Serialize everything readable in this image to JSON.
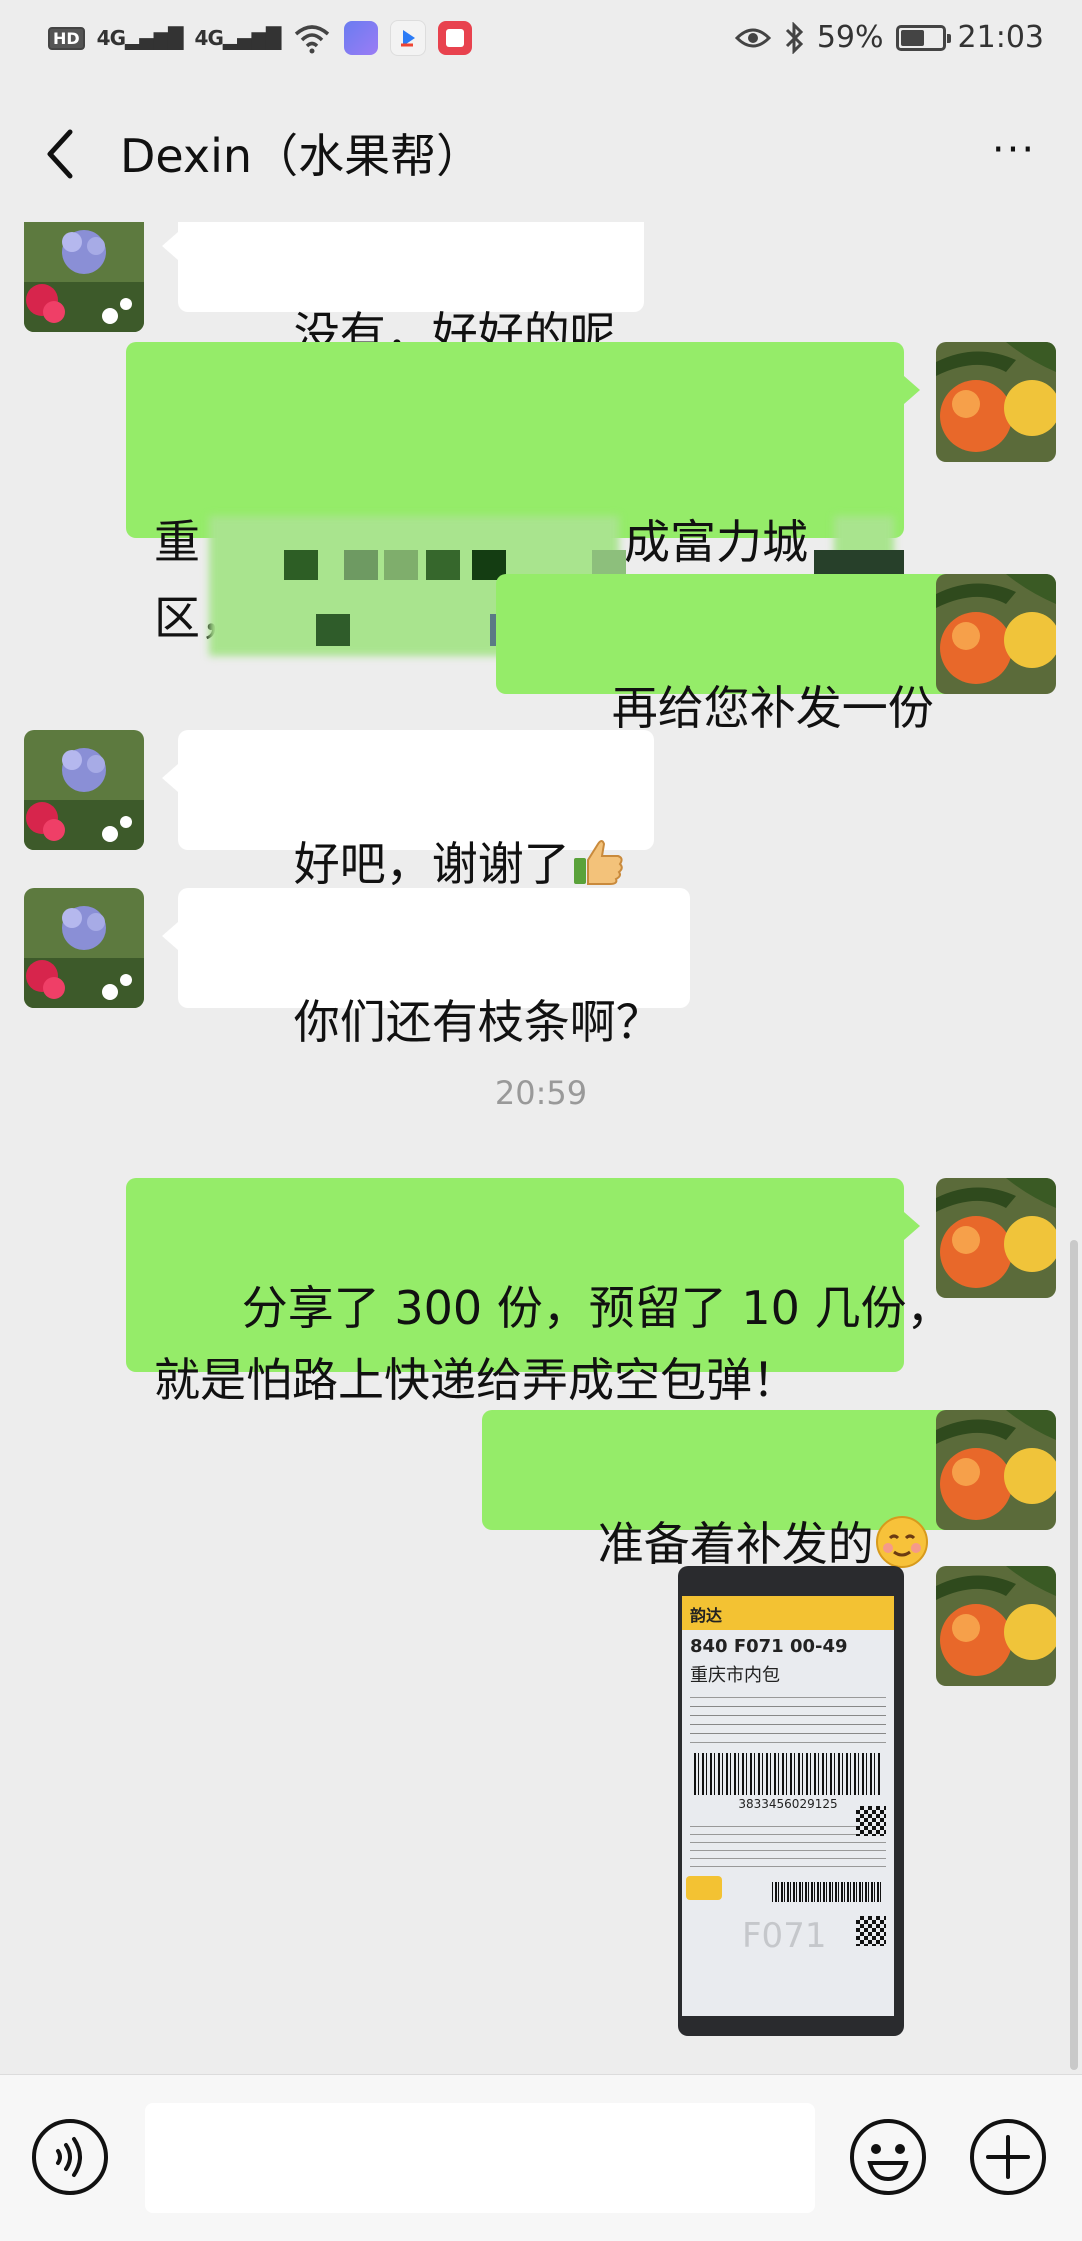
{
  "status_bar": {
    "hd": "HD",
    "sig1": "4G",
    "sig2": "4G",
    "battery_percent": "59%",
    "battery_level": 0.59,
    "time": "21:03"
  },
  "header": {
    "title": "Dexin（水果帮）",
    "more": "···"
  },
  "messages": [
    {
      "side": "in",
      "text": "没有，好好的呢"
    },
    {
      "side": "out",
      "line1": "重",
      "line1b": "成富力城",
      "line2": "区，先"
    },
    {
      "side": "out",
      "text": "再给您补发一份"
    },
    {
      "side": "in",
      "text": "好吧，谢谢了",
      "emoji": "thumbs-up"
    },
    {
      "side": "in",
      "text": "你们还有枝条啊？"
    },
    {
      "side": "out",
      "text": "分享了 300 份，预留了 10 几份，\n就是怕路上快递给弄成空包弹！"
    },
    {
      "side": "out",
      "text": "准备着补发的",
      "emoji": "smiling-face"
    },
    {
      "side": "out",
      "type": "image"
    }
  ],
  "timestamp": "20:59",
  "photo": {
    "carrier": "韵达",
    "code": "840  F071  00-49",
    "dest": "重庆市内包",
    "barcode_number": "3833456029125",
    "watermark": "F071"
  },
  "colors": {
    "background": "#ededed",
    "bubble_out": "#95ec69",
    "bubble_in": "#ffffff"
  },
  "icons": {
    "back": "chevron-left-icon",
    "more": "more-icon",
    "voice": "voice-icon",
    "emoji": "emoji-icon",
    "plus": "plus-icon"
  }
}
